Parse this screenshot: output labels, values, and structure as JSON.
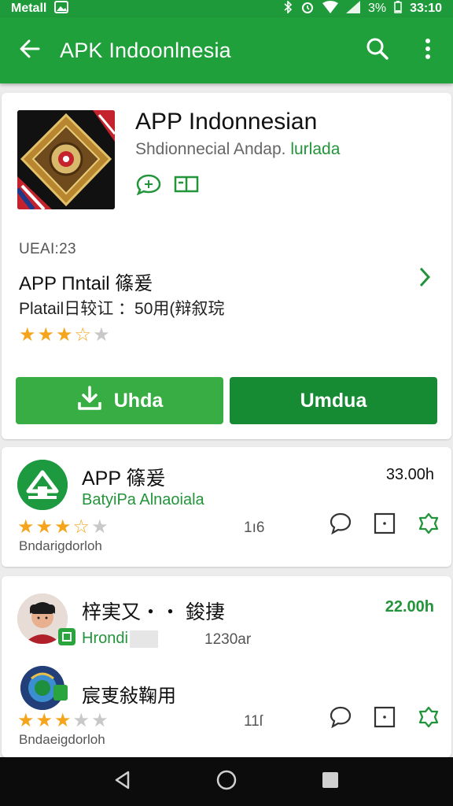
{
  "status_bar": {
    "carrier": "Metall",
    "battery": "3%",
    "time": "33:10"
  },
  "app_bar": {
    "title": "APK Indoonlnesia",
    "back_icon": "arrow-back-icon",
    "search_icon": "search-icon",
    "menu_icon": "more-vert-icon"
  },
  "app": {
    "name": "APP Indonnesian",
    "subtitle_prefix": "Shdionnecial Andap. ",
    "subtitle_green": "lurlada",
    "meta_label": "UEAI:23",
    "info_title": "APP Πntail 篠爰",
    "info_subtitle": "Platail日较讧 ：50用(辩叙琓",
    "rating": 3.5,
    "stars_total": 5
  },
  "buttons": {
    "primary": "Uhda",
    "secondary": "Umdua"
  },
  "list": [
    {
      "title": "APP 篠爰",
      "subtitle": "BatyiPa Alnaoiala",
      "size": "33.00h",
      "count": "1ı6",
      "author": "Bndarigdorloh",
      "rating": 3.5
    },
    {
      "title": "梓実又・・ 鋑捿",
      "subtitle": "Hrondi",
      "size": "22.00h",
      "count": "1230ar",
      "second_title": "宸叓敍鞠用"
    },
    {
      "count": "11ſ",
      "author": "Bndaeigdorloh",
      "rating": 3
    }
  ],
  "colors": {
    "app_bar": "#1fa03b",
    "accent": "#22943a",
    "star": "#f4a51c"
  }
}
